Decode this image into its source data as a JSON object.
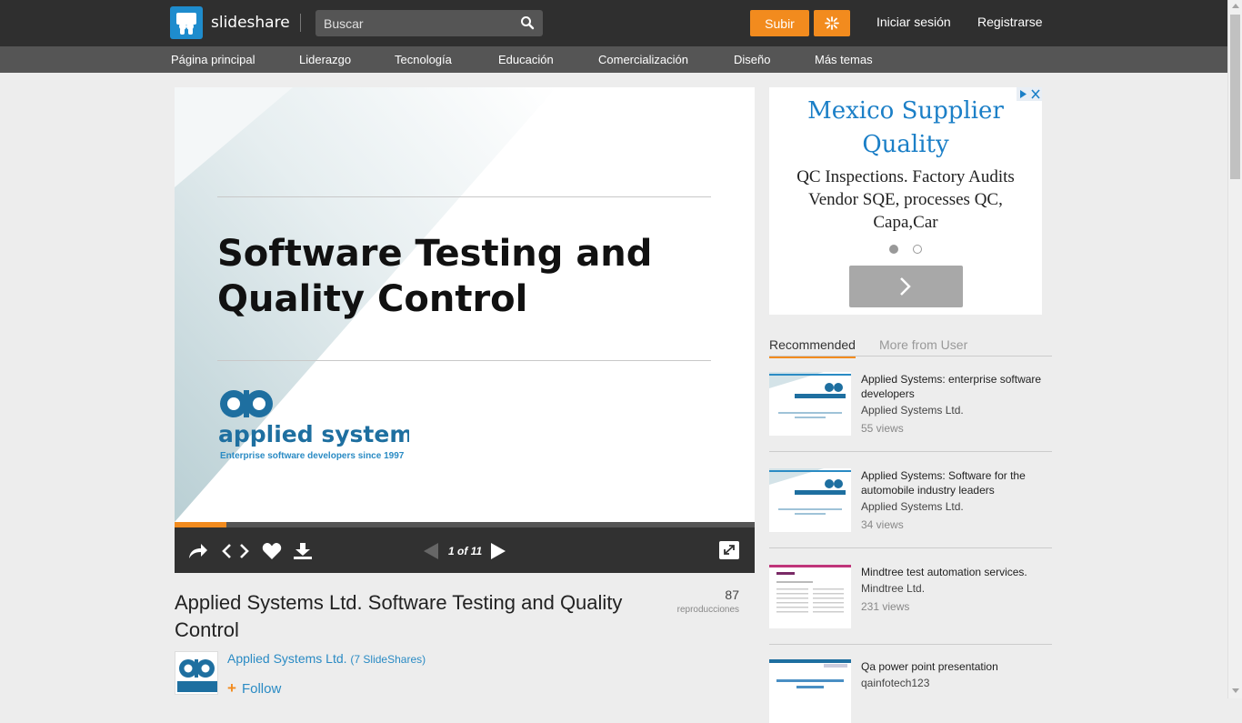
{
  "header": {
    "logo_text": "slideshare",
    "search_placeholder": "Buscar",
    "upload_label": "Subir",
    "login_label": "Iniciar sesión",
    "register_label": "Registrarse"
  },
  "categories": [
    "Página principal",
    "Liderazgo",
    "Tecnología",
    "Educación",
    "Comercialización",
    "Diseño",
    "Más temas"
  ],
  "slide": {
    "title": "Software Testing and\nQuality Control",
    "logo_text": "applied systems",
    "tagline": "Enterprise software developers since 1997"
  },
  "player": {
    "page_indicator": "1 of 11",
    "progress": 0.09
  },
  "document": {
    "title": "Applied Systems Ltd. Software Testing and Quality Control",
    "views": "87",
    "views_label": "reproducciones",
    "author": "Applied Systems Ltd.",
    "author_count": "(7 SlideShares)",
    "follow_label": "Follow"
  },
  "ad": {
    "title": "Mexico Supplier Quality",
    "body": "QC Inspections. Factory Audits Vendor SQE, processes QC, Capa,Car"
  },
  "tabs": {
    "recommended": "Recommended",
    "more": "More from User"
  },
  "recommended": [
    {
      "title": "Applied Systems: enterprise software developers",
      "author": "Applied Systems Ltd.",
      "views": "55 views"
    },
    {
      "title": "Applied Systems: Software for the automobile industry leaders",
      "author": "Applied Systems Ltd.",
      "views": "34 views"
    },
    {
      "title": "Mindtree test automation services.",
      "author": "Mindtree Ltd.",
      "views": "231 views"
    },
    {
      "title": "Qa power point presentation",
      "author": "qainfotech123",
      "views": ""
    }
  ],
  "colors": {
    "accent": "#f28b1e",
    "link": "#2a8bc4",
    "brand": "#1e8ccd"
  }
}
